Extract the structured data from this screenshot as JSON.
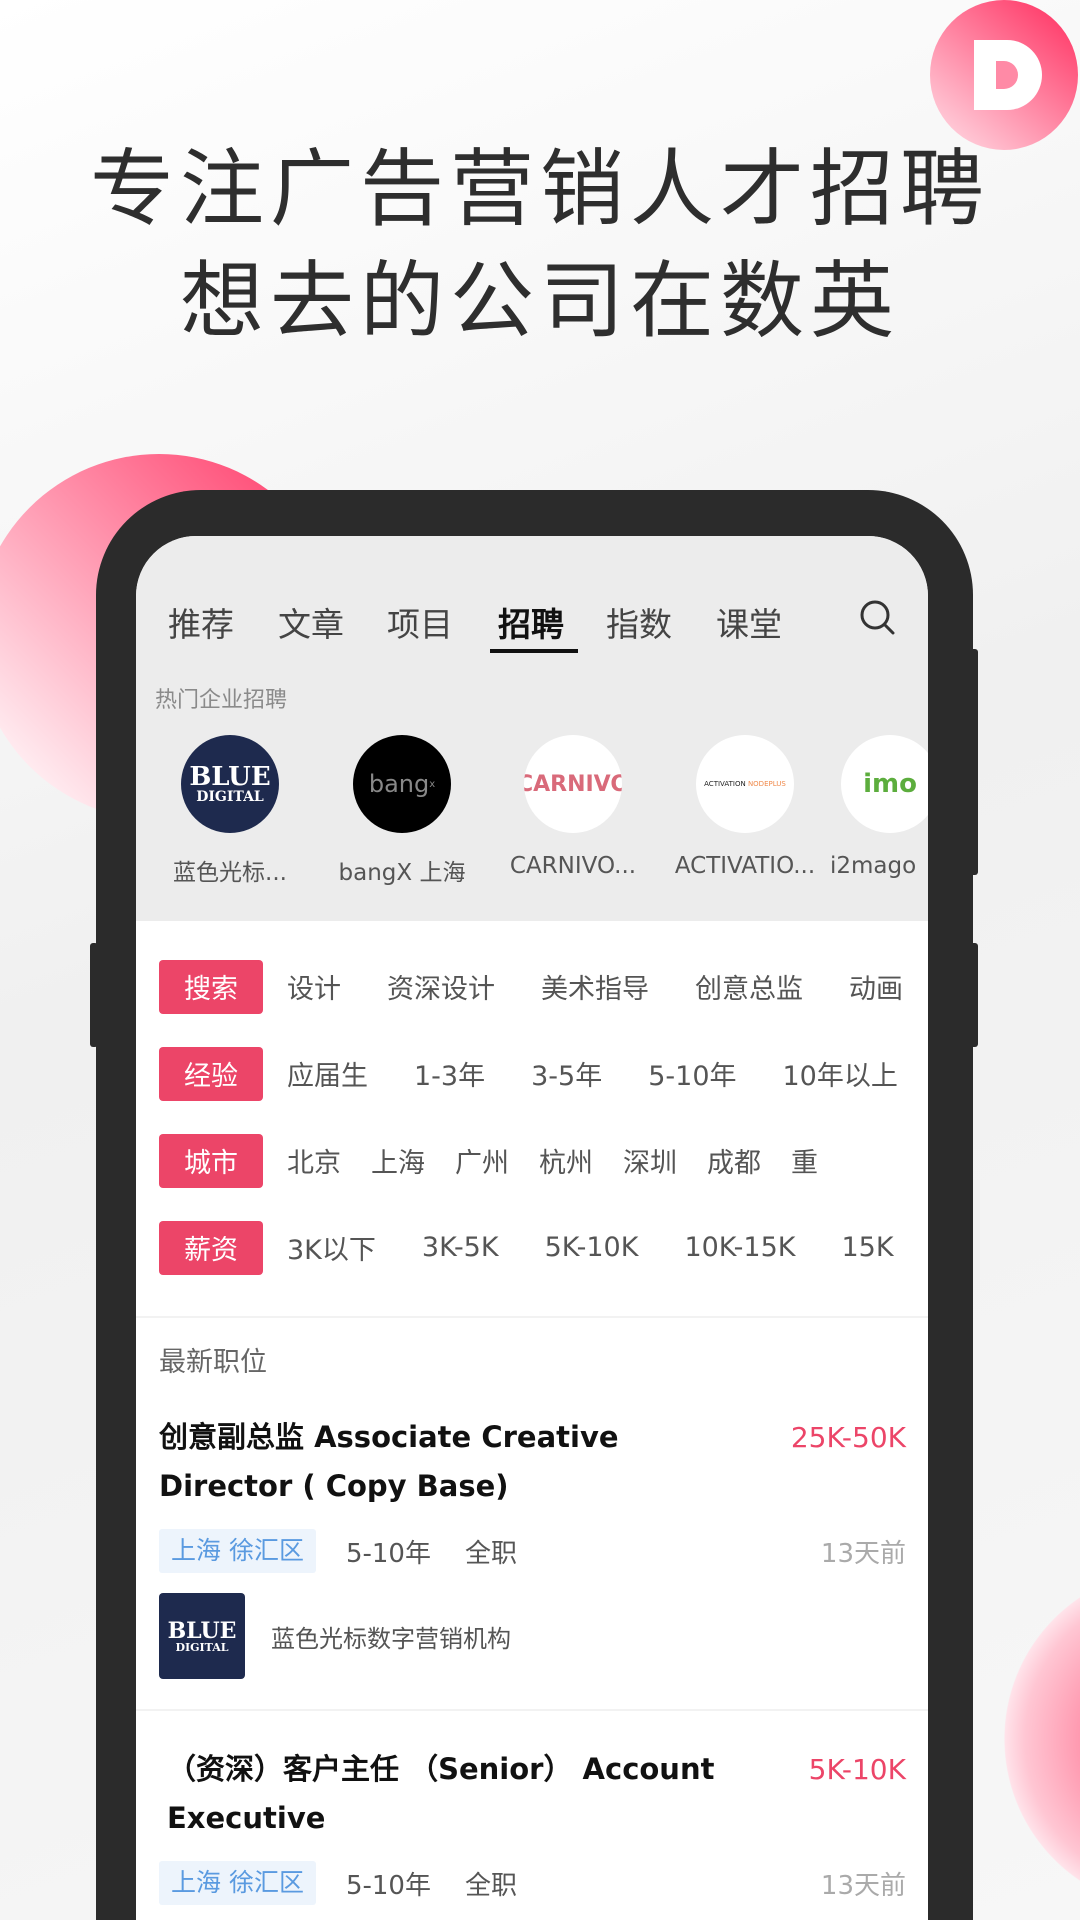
{
  "promo": {
    "line1": "专注广告营销人才招聘",
    "line2": "想去的公司在数英",
    "brand_logo": "D"
  },
  "colors": {
    "accent": "#ec4568",
    "brand": "#ff3c6a",
    "location_chip": "#5a9ae0"
  },
  "nav": {
    "tabs": [
      {
        "label": "推荐"
      },
      {
        "label": "文章"
      },
      {
        "label": "项目"
      },
      {
        "label": "招聘",
        "active": true
      },
      {
        "label": "指数"
      },
      {
        "label": "课堂"
      }
    ],
    "search_icon": "search-icon"
  },
  "hot": {
    "title": "热门企业招聘",
    "companies": [
      {
        "name": "蓝色光标...",
        "logo": "BLUE DIGITAL"
      },
      {
        "name": "bangX 上海",
        "logo": "bang"
      },
      {
        "name": "CARNIVO...",
        "logo": "CARNIVO"
      },
      {
        "name": "ACTIVATIO...",
        "logo": "ACTIVATION NODEPLUS"
      },
      {
        "name": "i2mago",
        "logo": "imo"
      }
    ]
  },
  "filters": [
    {
      "tag": "搜索",
      "items": [
        "设计",
        "资深设计",
        "美术指导",
        "创意总监",
        "动画"
      ]
    },
    {
      "tag": "经验",
      "items": [
        "应届生",
        "1-3年",
        "3-5年",
        "5-10年",
        "10年以上"
      ]
    },
    {
      "tag": "城市",
      "items": [
        "北京",
        "上海",
        "广州",
        "杭州",
        "深圳",
        "成都",
        "重"
      ]
    },
    {
      "tag": "薪资",
      "items": [
        "3K以下",
        "3K-5K",
        "5K-10K",
        "10K-15K",
        "15K"
      ]
    }
  ],
  "latest": {
    "title": "最新职位",
    "jobs": [
      {
        "title": "创意副总监 Associate Creative Director ( Copy Base)",
        "salary": "25K-50K",
        "location": "上海 徐汇区",
        "experience": "5-10年",
        "type": "全职",
        "posted": "13天前",
        "company": "蓝色光标数字营销机构"
      },
      {
        "title": "（资深）客户主任 （Senior） Account Executive",
        "salary": "5K-10K",
        "location": "上海 徐汇区",
        "experience": "5-10年",
        "type": "全职",
        "posted": "13天前"
      }
    ]
  }
}
